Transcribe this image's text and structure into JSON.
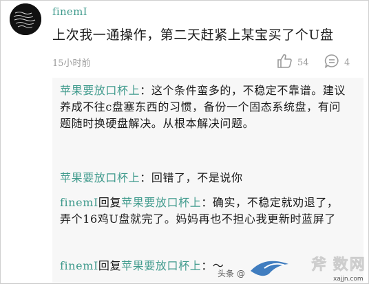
{
  "post": {
    "username": "finemI",
    "comment": "上次我一通操作，第二天赶紧上某宝买了个U盘",
    "time": "15小时前",
    "likes": "54",
    "replies_count": "4"
  },
  "replies": [
    {
      "author": "苹果要放口杯上",
      "sep": "：",
      "text": "这个条件蛮多的，不稳定不靠谱。建议养成不往c盘塞东西的习惯，备份一个固态系统盘，有问题随时换硬盘解决。从根本解决问题。"
    },
    {
      "author": "苹果要放口杯上",
      "sep": "：",
      "text": "回错了，不是说你"
    },
    {
      "author": "finemI",
      "mid": "回复",
      "target": "苹果要放口杯上",
      "sep": "：",
      "text": "确实，不稳定就劝退了，弄个16鸡U盘就完了。妈妈再也不担心我更新时蓝屏了"
    },
    {
      "author": "finemI",
      "mid": "回复",
      "target": "苹果要放口杯上",
      "sep": "：",
      "text": "〜"
    }
  ],
  "watermark": {
    "text": "头条 @",
    "logo_text": "xajjn.com"
  },
  "colors": {
    "link": "#3f9a8c",
    "muted": "#9a9a9a",
    "reply_bg": "#f7f7f7"
  },
  "icons": {
    "like": "thumbs-up-icon",
    "reply": "comment-bubble-icon"
  }
}
